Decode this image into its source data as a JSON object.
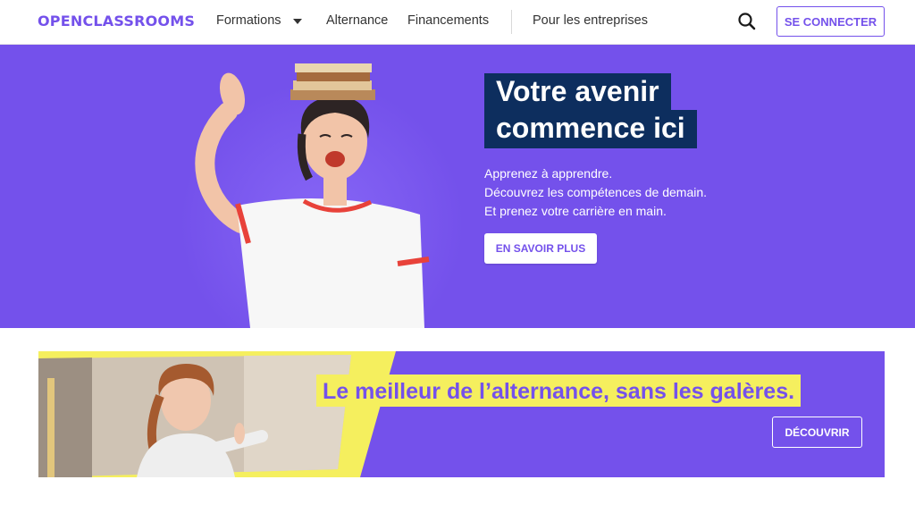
{
  "navbar": {
    "logo_text": "OPENCLASSROOMS",
    "items": [
      {
        "label": "Formations",
        "has_dropdown": true
      },
      {
        "label": "Alternance"
      },
      {
        "label": "Financements"
      },
      {
        "label": "Pour les entreprises"
      }
    ],
    "search_icon": "search-icon",
    "login_label": "SE CONNECTER"
  },
  "hero": {
    "headline_line1": "Votre avenir",
    "headline_line2": "commence ici",
    "lines": [
      "Apprenez à apprendre.",
      "Découvrez les compétences de demain.",
      "Et prenez votre carrière en main."
    ],
    "cta_label": "EN SAVOIR PLUS"
  },
  "banner": {
    "headline": "Le meilleur de l’alternance, sans les galères.",
    "cta_label": "DÉCOUVRIR"
  },
  "colors": {
    "brand_purple": "#7451eb",
    "headline_navy": "#0d2e5e",
    "highlight_yellow": "#f5ef5e",
    "white": "#ffffff"
  }
}
